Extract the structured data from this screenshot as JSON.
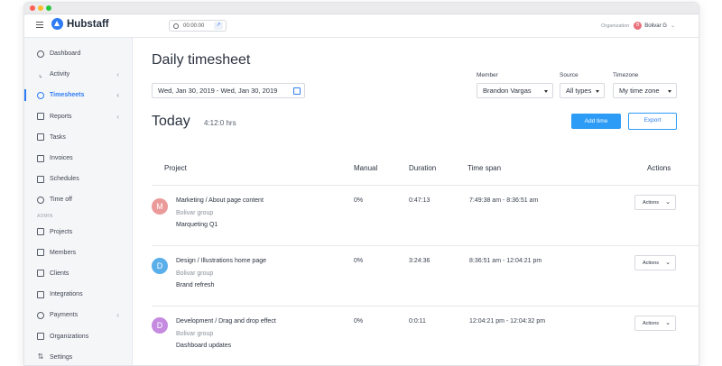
{
  "app": {
    "name": "Hubstaff"
  },
  "timer": {
    "value": "00:00:00"
  },
  "org": {
    "label": "Organization",
    "avatar_letter": "B",
    "user": "Bolivar G",
    "avatar_color": "#e8707b"
  },
  "sidebar": {
    "items": [
      {
        "label": "Dashboard",
        "icon": "dashboard-icon"
      },
      {
        "label": "Activity",
        "icon": "activity-icon"
      },
      {
        "label": "Timesheets",
        "icon": "clock-icon"
      },
      {
        "label": "Reports",
        "icon": "reports-icon"
      },
      {
        "label": "Tasks",
        "icon": "tasks-icon"
      },
      {
        "label": "Invoices",
        "icon": "invoices-icon"
      },
      {
        "label": "Schedules",
        "icon": "schedules-icon"
      },
      {
        "label": "Time off",
        "icon": "time-off-icon"
      }
    ],
    "section_admin": "ADMIN",
    "admin_items": [
      {
        "label": "Projects",
        "icon": "folder-icon"
      },
      {
        "label": "Members",
        "icon": "members-icon"
      },
      {
        "label": "Clients",
        "icon": "clients-icon"
      },
      {
        "label": "Integrations",
        "icon": "integrations-icon"
      },
      {
        "label": "Payments",
        "icon": "payments-icon"
      },
      {
        "label": "Organizations",
        "icon": "organizations-icon"
      },
      {
        "label": "Settings",
        "icon": "settings-icon"
      }
    ]
  },
  "page": {
    "title": "Daily timesheet",
    "date_range": "Wed, Jan 30, 2019 - Wed, Jan 30, 2019",
    "filters": {
      "member_label": "Member",
      "member_value": "Brandon Vargas",
      "source_label": "Source",
      "source_value": "All types",
      "timezone_label": "Timezone",
      "timezone_value": "My time zone"
    },
    "today_label": "Today",
    "today_hours": "4:12:0 hrs",
    "add_time": "Add time",
    "export": "Export"
  },
  "table": {
    "headers": {
      "project": "Project",
      "manual": "Manual",
      "duration": "Duration",
      "time_span": "Time span",
      "actions": "Actions"
    },
    "rows": [
      {
        "letter": "M",
        "color": "#eb9a9a",
        "title": "Marketing / About page content",
        "group": "Bolivar group",
        "tag": "Marqueting Q1",
        "manual": "0%",
        "duration": "0:47:13",
        "span": "7:49:38 am - 8:36:51 am",
        "action": "Actions"
      },
      {
        "letter": "D",
        "color": "#5aaeea",
        "title": "Design / Illustrations home page",
        "group": "Bolivar group",
        "tag": "Brand refresh",
        "manual": "0%",
        "duration": "3:24:36",
        "span": "8:36:51 am - 12:04:21 pm",
        "action": "Actions"
      },
      {
        "letter": "D",
        "color": "#c58be0",
        "title": "Development / Drag and drop effect",
        "group": "Bolivar group",
        "tag": "Dashboard updates",
        "manual": "0%",
        "duration": "0:0:11",
        "span": "12:04:21 pm - 12:04:32 pm",
        "action": "Actions"
      }
    ]
  }
}
